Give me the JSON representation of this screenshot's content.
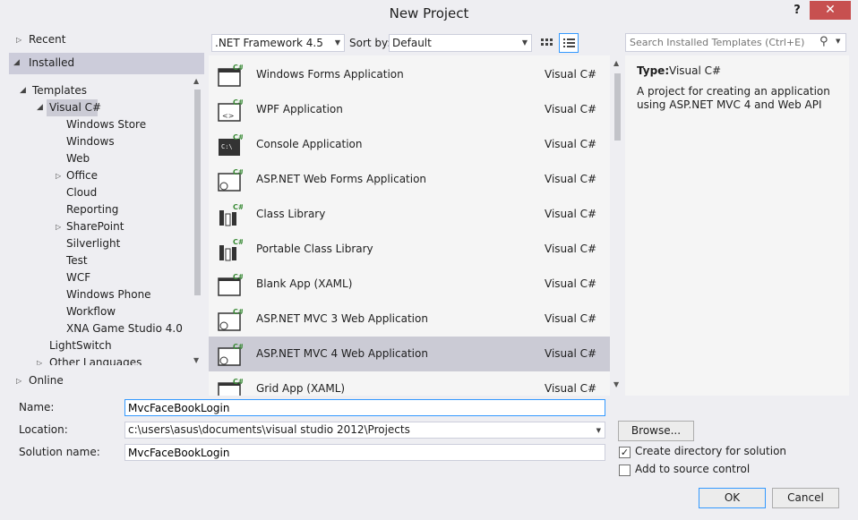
{
  "window": {
    "title": "New Project",
    "help_label": "?",
    "close_label": "✕"
  },
  "left_tree": {
    "recent": "Recent",
    "installed": "Installed",
    "templates": "Templates",
    "visual_csharp": "Visual C#",
    "children": [
      "Windows Store",
      "Windows",
      "Web",
      "Office",
      "Cloud",
      "Reporting",
      "SharePoint",
      "Silverlight",
      "Test",
      "WCF",
      "Windows Phone",
      "Workflow",
      "XNA Game Studio 4.0"
    ],
    "lightswitch": "LightSwitch",
    "other_languages": "Other Languages",
    "online": "Online"
  },
  "toolbar": {
    "framework": ".NET Framework 4.5",
    "sort_by_label": "Sort by:",
    "sort_value": "Default",
    "search_placeholder": "Search Installed Templates (Ctrl+E)"
  },
  "templates": [
    {
      "name": "Windows Forms Application",
      "lang": "Visual C#"
    },
    {
      "name": "WPF Application",
      "lang": "Visual C#"
    },
    {
      "name": "Console Application",
      "lang": "Visual C#"
    },
    {
      "name": "ASP.NET Web Forms Application",
      "lang": "Visual C#"
    },
    {
      "name": "Class Library",
      "lang": "Visual C#"
    },
    {
      "name": "Portable Class Library",
      "lang": "Visual C#"
    },
    {
      "name": "Blank App (XAML)",
      "lang": "Visual C#"
    },
    {
      "name": "ASP.NET MVC 3 Web Application",
      "lang": "Visual C#"
    },
    {
      "name": "ASP.NET MVC 4 Web Application",
      "lang": "Visual C#"
    },
    {
      "name": "Grid App (XAML)",
      "lang": "Visual C#"
    }
  ],
  "details": {
    "type_label": "Type:",
    "type_value": "Visual C#",
    "description": "A project for creating an application using ASP.NET MVC 4 and Web API"
  },
  "form": {
    "name_label": "Name:",
    "name_value": "MvcFaceBookLogin",
    "location_label": "Location:",
    "location_value": "c:\\users\\asus\\documents\\visual studio 2012\\Projects",
    "solution_label": "Solution name:",
    "solution_value": "MvcFaceBookLogin",
    "browse_label": "Browse...",
    "create_dir_label": "Create directory for solution",
    "source_control_label": "Add to source control",
    "ok_label": "OK",
    "cancel_label": "Cancel"
  },
  "colors": {
    "accent": "#3399ff",
    "selection": "#cbcbd5",
    "close": "#c75050",
    "csharp_badge": "#388a34"
  }
}
